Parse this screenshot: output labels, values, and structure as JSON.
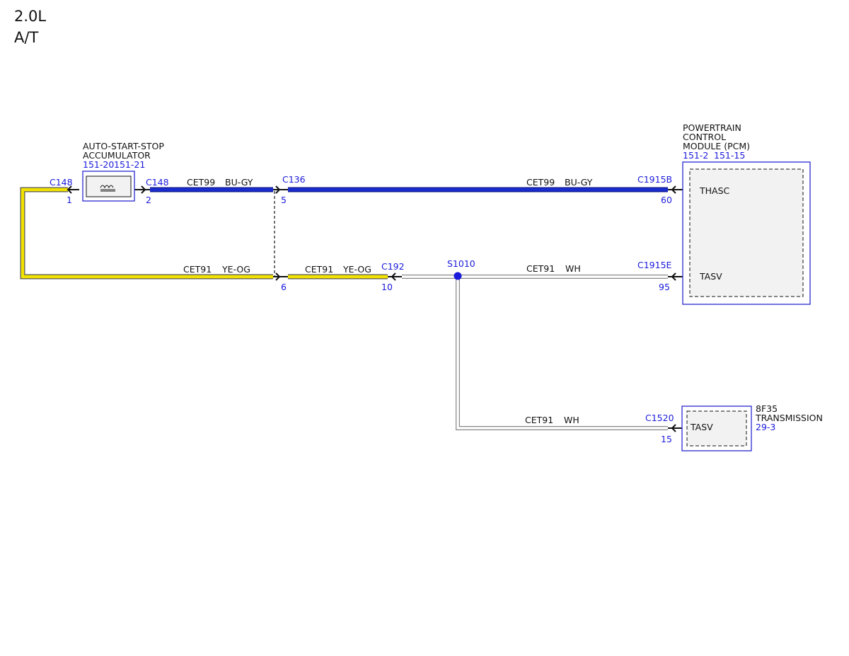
{
  "header": {
    "engine": "2.0L",
    "transmission": "A/T"
  },
  "components": {
    "accumulator": {
      "name_line1": "AUTO-START-STOP",
      "name_line2": "ACCUMULATOR",
      "ref1": "151-20",
      "ref2": "151-21"
    },
    "pcm": {
      "name_line1": "POWERTRAIN",
      "name_line2": "CONTROL",
      "name_line3": "MODULE (PCM)",
      "ref1": "151-2",
      "ref2": "151-15",
      "pin_thasc": "THASC",
      "pin_tasv": "TASV"
    },
    "transmission": {
      "name_line1": "8F35",
      "name_line2": "TRANSMISSION",
      "ref": "29-3",
      "pin_tasv": "TASV"
    }
  },
  "connectors": {
    "c148_left": {
      "id": "C148",
      "pin": "1"
    },
    "c148_right": {
      "id": "C148",
      "pin": "2"
    },
    "c136_top": {
      "id": "C136",
      "pin": "5"
    },
    "c136_bottom": {
      "pin": "6"
    },
    "c192": {
      "id": "C192",
      "pin": "10"
    },
    "c1915b": {
      "id": "C1915B",
      "pin": "60"
    },
    "c1915e": {
      "id": "C1915E",
      "pin": "95"
    },
    "c1520": {
      "id": "C1520",
      "pin": "15"
    }
  },
  "splice": {
    "id": "S1010"
  },
  "wires": {
    "w1": {
      "circuit": "CET99",
      "color": "BU-GY"
    },
    "w2": {
      "circuit": "CET99",
      "color": "BU-GY"
    },
    "w3": {
      "circuit": "CET91",
      "color": "YE-OG"
    },
    "w4": {
      "circuit": "CET91",
      "color": "YE-OG"
    },
    "w5": {
      "circuit": "CET91",
      "color": "WH"
    },
    "w6": {
      "circuit": "CET91",
      "color": "WH"
    }
  },
  "colors": {
    "blue_wire": "#1a2bd0",
    "yellow_wire": "#f2e200",
    "label_blue": "#1a1adb",
    "box_border": "#2a2ad0",
    "box_fill": "#f2f2f2"
  }
}
